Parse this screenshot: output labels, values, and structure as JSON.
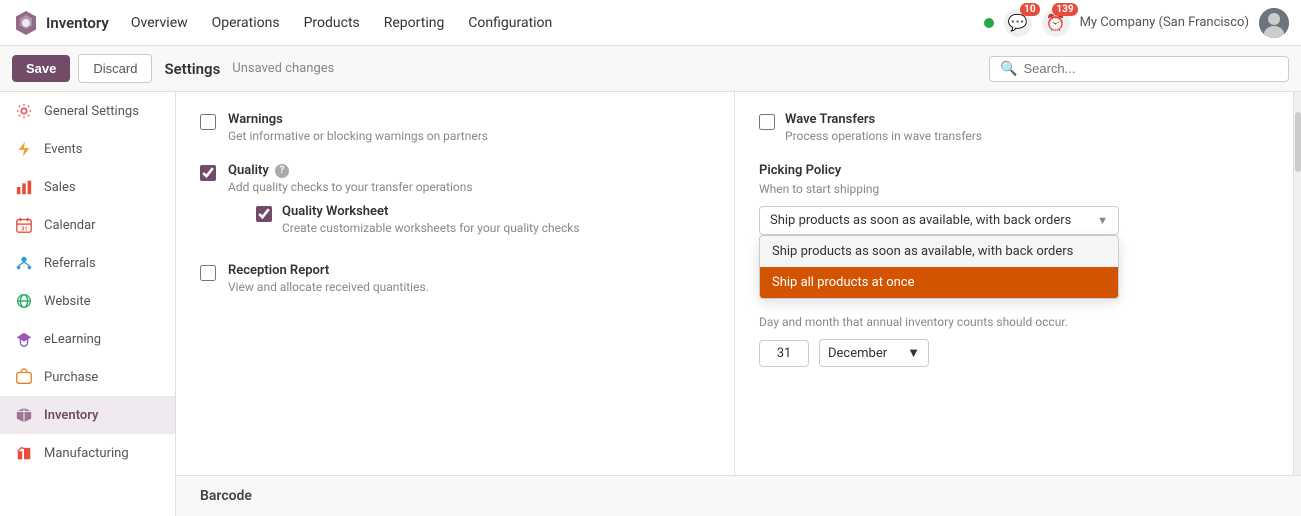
{
  "topnav": {
    "brand": "Inventory",
    "items": [
      "Overview",
      "Operations",
      "Products",
      "Reporting",
      "Configuration"
    ],
    "company": "My Company (San Francisco)",
    "msg_badge": "10",
    "activity_badge": "139"
  },
  "actionbar": {
    "save_label": "Save",
    "discard_label": "Discard",
    "title": "Settings",
    "unsaved": "Unsaved changes",
    "search_placeholder": "Search..."
  },
  "sidebar": {
    "items": [
      {
        "label": "General Settings",
        "icon": "gear"
      },
      {
        "label": "Events",
        "icon": "lightning"
      },
      {
        "label": "Sales",
        "icon": "bar-chart"
      },
      {
        "label": "Calendar",
        "icon": "calendar"
      },
      {
        "label": "Referrals",
        "icon": "referral"
      },
      {
        "label": "Website",
        "icon": "globe"
      },
      {
        "label": "eLearning",
        "icon": "graduation"
      },
      {
        "label": "Purchase",
        "icon": "purchase"
      },
      {
        "label": "Inventory",
        "icon": "inventory"
      },
      {
        "label": "Manufacturing",
        "icon": "manufacturing"
      }
    ]
  },
  "left_panel": {
    "warnings": {
      "title": "Warnings",
      "desc": "Get informative or blocking warnings on partners",
      "checked": false
    },
    "quality": {
      "title": "Quality",
      "desc": "Add quality checks to your transfer operations",
      "checked": true
    },
    "quality_worksheet": {
      "title": "Quality Worksheet",
      "desc": "Create customizable worksheets for your quality checks",
      "checked": true
    },
    "reception_report": {
      "title": "Reception Report",
      "desc": "View and allocate received quantities.",
      "checked": false
    }
  },
  "right_panel": {
    "wave_transfers": {
      "title": "Wave Transfers",
      "desc": "Process operations in wave transfers",
      "checked": false
    },
    "picking_policy": {
      "label": "Picking Policy",
      "desc": "When to start shipping"
    },
    "dropdown": {
      "current_value": "Ship products as soon as available, with back orders",
      "options": [
        {
          "label": "Ship products as soon as available, with back orders",
          "selected": false
        },
        {
          "label": "Ship all products at once",
          "selected": true
        }
      ],
      "arrow": "▼"
    },
    "annual_inventory_text": "Day and month that annual inventory counts should occur.",
    "day": "31",
    "month": "December",
    "month_arrow": "▼"
  },
  "barcode": {
    "label": "Barcode"
  }
}
